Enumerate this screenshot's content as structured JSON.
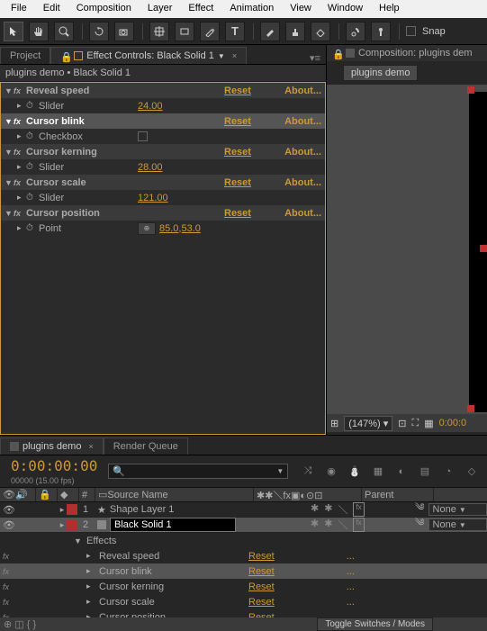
{
  "menu": [
    "File",
    "Edit",
    "Composition",
    "Layer",
    "Effect",
    "Animation",
    "View",
    "Window",
    "Help"
  ],
  "toolbar": {
    "snap": "Snap"
  },
  "tabs": {
    "project": "Project",
    "effect_controls": "Effect Controls: Black Solid 1",
    "composition": "Composition: plugins dem"
  },
  "ec_breadcrumb": "plugins demo • Black Solid 1",
  "ec_minitab": "plugins demo",
  "effects": [
    {
      "name": "Reveal speed",
      "reset": "Reset",
      "about": "About...",
      "sel": false,
      "props": [
        {
          "type": "slider",
          "name": "Slider",
          "val": "24.00"
        }
      ]
    },
    {
      "name": "Cursor blink",
      "reset": "Reset",
      "about": "About...",
      "sel": true,
      "props": [
        {
          "type": "check",
          "name": "Checkbox"
        }
      ]
    },
    {
      "name": "Cursor kerning",
      "reset": "Reset",
      "about": "About...",
      "sel": false,
      "props": [
        {
          "type": "slider",
          "name": "Slider",
          "val": "28.00"
        }
      ]
    },
    {
      "name": "Cursor scale",
      "reset": "Reset",
      "about": "About...",
      "sel": false,
      "props": [
        {
          "type": "slider",
          "name": "Slider",
          "val": "121.00"
        }
      ]
    },
    {
      "name": "Cursor position",
      "reset": "Reset",
      "about": "About...",
      "sel": false,
      "props": [
        {
          "type": "point",
          "name": "Point",
          "val": "85.0,53.0"
        }
      ]
    }
  ],
  "viewer": {
    "zoom": "(147%)",
    "time": "0:00:0"
  },
  "timeline": {
    "tab": "plugins demo",
    "tab2": "Render Queue",
    "timecode": "0:00:00:00",
    "timecode_sub": "00000 (15.00 fps)",
    "col_num": "#",
    "col_src": "Source Name",
    "col_parent": "Parent",
    "layers": [
      {
        "num": "1",
        "name": "Shape Layer 1",
        "color": "#b03030",
        "sel": false,
        "star": true,
        "parent": "None"
      },
      {
        "num": "2",
        "name": "Black Solid 1",
        "color": "#b03030",
        "sel": true,
        "star": false,
        "parent": "None"
      }
    ],
    "effects_hdr": "Effects",
    "layer_fx": [
      {
        "name": "Reveal speed",
        "reset": "Reset",
        "sel": false
      },
      {
        "name": "Cursor blink",
        "reset": "Reset",
        "sel": true
      },
      {
        "name": "Cursor kerning",
        "reset": "Reset",
        "sel": false
      },
      {
        "name": "Cursor scale",
        "reset": "Reset",
        "sel": false
      },
      {
        "name": "Cursor position",
        "reset": "Reset",
        "sel": false
      }
    ],
    "toggle": "Toggle Switches / Modes"
  }
}
